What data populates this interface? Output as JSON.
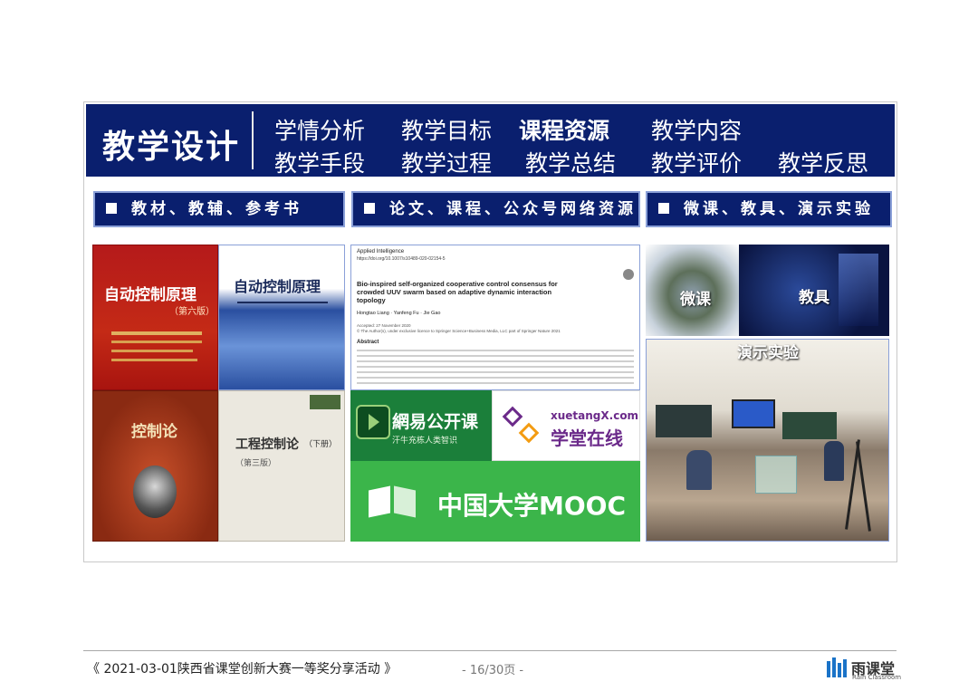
{
  "banner": {
    "title": "教学设计",
    "nav_row1": [
      "学情分析",
      "教学目标",
      "课程资源",
      "教学内容"
    ],
    "nav_row2": [
      "教学手段",
      "教学过程",
      "教学总结",
      "教学评价",
      "教学反思"
    ],
    "active": "课程资源"
  },
  "categories": [
    "教材、教辅、参考书",
    "论文、课程、公众号网络资源",
    "微课、教具、演示实验"
  ],
  "books": {
    "b1_title": "自动控制原理",
    "b1_edition": "（第六版）",
    "b2_title": "自动控制原理",
    "b3_title": "控制论",
    "b4_title": "工程控制论",
    "b4_paren": "（下册）",
    "b4_edition": "（第三版）"
  },
  "paper": {
    "journal": "Applied Intelligence",
    "doi": "https://doi.org/10.1007/s10489-020-02154-5",
    "title": "Bio-inspired self-organized cooperative control consensus for crowded UUV swarm based on adaptive dynamic interaction topology",
    "authors": "Hongtao Liang · Yanfeng Fu · Jie Gao",
    "accepted": "Accepted: 27 November 2020",
    "license": "© The Author(s), under exclusive licence to Springer Science+Business Media, LLC part of Springer Nature 2021",
    "abstract_heading": "Abstract"
  },
  "platforms": {
    "netease": "網易公开课",
    "netease_slogan": "汗牛充栋人类智识",
    "xuetang_en": "xuetangX.com",
    "xuetang_cn": "学堂在线",
    "mooc": "中国大学MOOC"
  },
  "media": {
    "micro": "微课",
    "tools": "教具",
    "demo": "演示实验"
  },
  "footer": {
    "event": "《 2021-03-01陕西省课堂创新大赛一等奖分享活动 》",
    "page": "- 16/30页 -",
    "logo_name": "雨课堂",
    "logo_sub": "Rain Classroom"
  },
  "colors": {
    "banner_bg": "#0a1f6e",
    "mooc_green": "#3bb54a",
    "netease_green": "#1b7f3a",
    "xuetang_purple": "#6b2a8a"
  }
}
